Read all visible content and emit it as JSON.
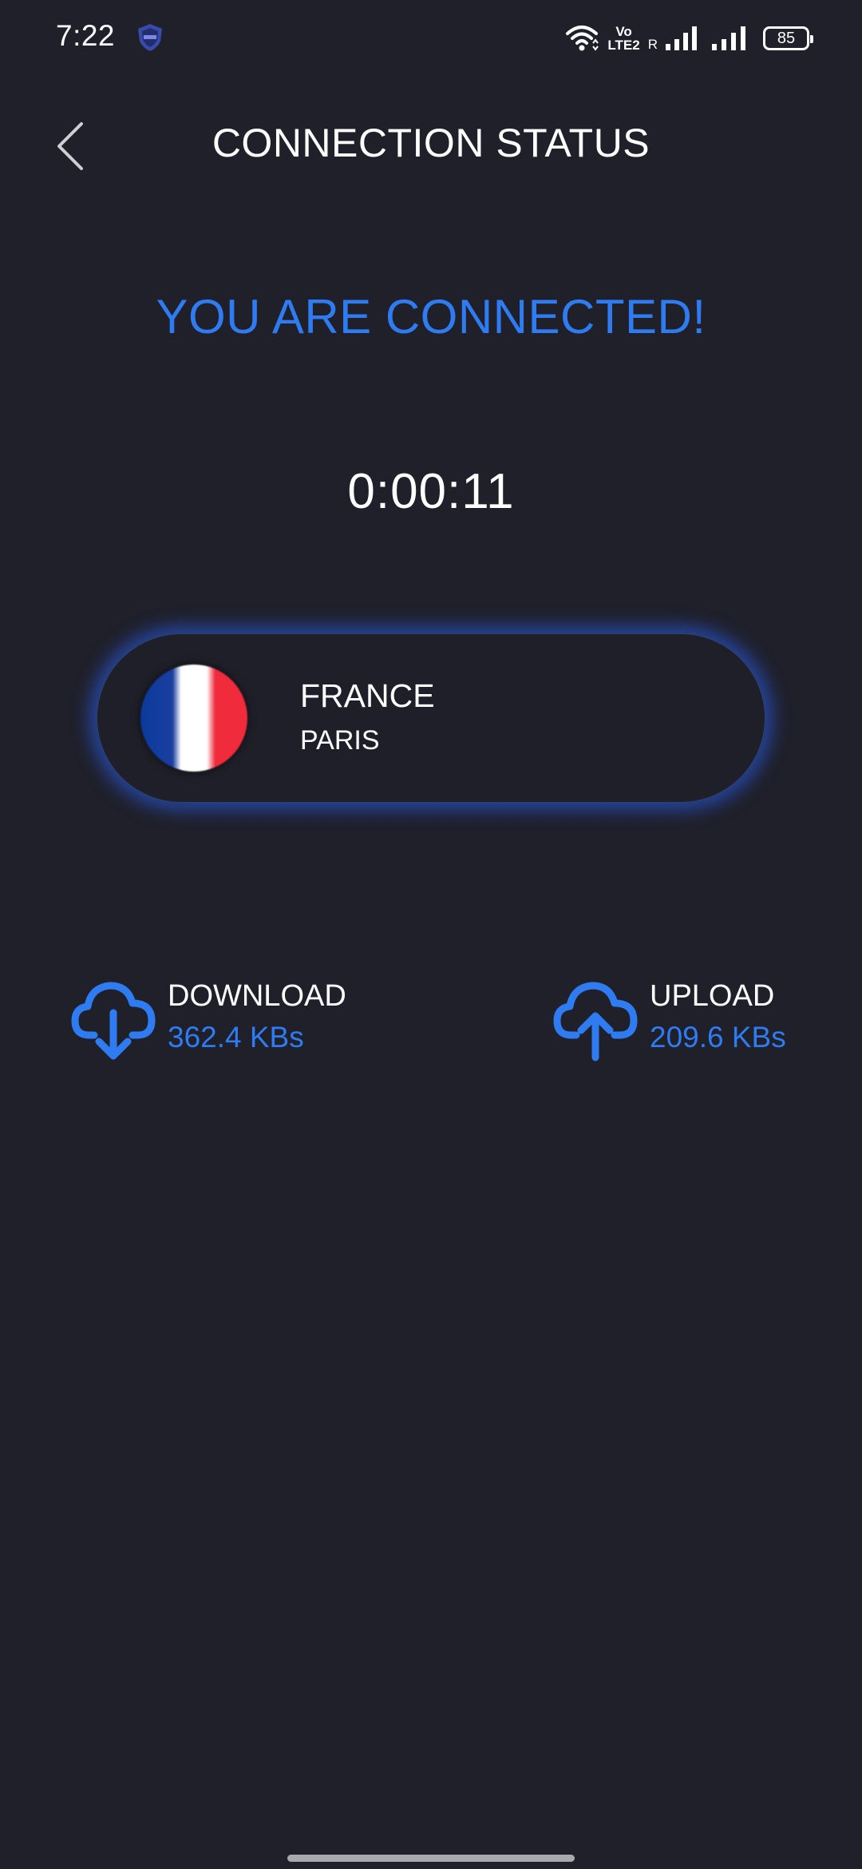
{
  "status_bar": {
    "time": "7:22",
    "app_icon": "vpn-shield-icon",
    "volte_top": "Vo",
    "volte_bottom": "LTE2",
    "roaming": "R",
    "battery": "85"
  },
  "header": {
    "back_icon": "chevron-left-icon",
    "title": "CONNECTION STATUS"
  },
  "status_message": "YOU ARE CONNECTED!",
  "timer": "0:00:11",
  "server": {
    "flag_icon": "france-flag-icon",
    "country": "FRANCE",
    "city": "PARIS"
  },
  "stats": {
    "download": {
      "icon": "cloud-download-icon",
      "label": "DOWNLOAD",
      "value": "362.4 KBs"
    },
    "upload": {
      "icon": "cloud-upload-icon",
      "label": "UPLOAD",
      "value": "209.6 KBs"
    }
  },
  "colors": {
    "background": "#20202b",
    "accent": "#2f7bf2",
    "text": "#ffffff"
  }
}
